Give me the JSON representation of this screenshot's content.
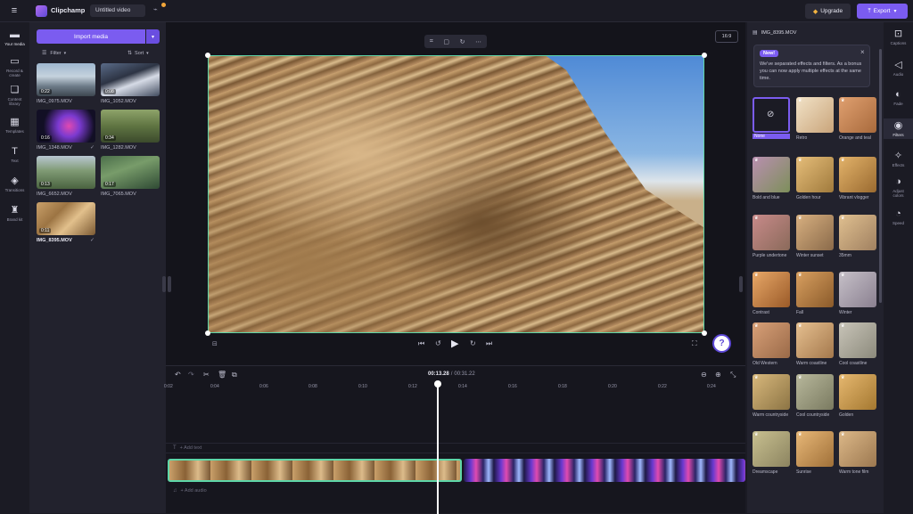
{
  "app": {
    "name": "Clipchamp",
    "project_title": "Untitled video"
  },
  "topbar": {
    "upgrade_label": "Upgrade",
    "export_label": "Export"
  },
  "left_rail": [
    {
      "label": "Your media",
      "icon": "folder-icon"
    },
    {
      "label": "Record & create",
      "icon": "camera-icon"
    },
    {
      "label": "Content library",
      "icon": "library-icon"
    },
    {
      "label": "Templates",
      "icon": "templates-icon"
    },
    {
      "label": "Text",
      "icon": "text-icon"
    },
    {
      "label": "Transitions",
      "icon": "transitions-icon"
    },
    {
      "label": "Brand kit",
      "icon": "brandkit-icon"
    }
  ],
  "media": {
    "import_label": "Import media",
    "filter_label": "Filter",
    "sort_label": "Sort",
    "items": [
      {
        "name": "IMG_0975.MOV",
        "duration": "0:22"
      },
      {
        "name": "IMG_1052.MOV",
        "duration": "0:08"
      },
      {
        "name": "IMG_1348.MOV",
        "duration": "0:16"
      },
      {
        "name": "IMG_1282.MOV",
        "duration": "0:34"
      },
      {
        "name": "IMG_6652.MOV",
        "duration": "0:13"
      },
      {
        "name": "IMG_7065.MOV",
        "duration": "0:17"
      },
      {
        "name": "IMG_8395.MOV",
        "duration": "0:11"
      }
    ]
  },
  "preview": {
    "aspect_ratio": "16:9"
  },
  "timeline": {
    "current_time": "00:13.28",
    "total_time": "00:31.22",
    "separator": "/",
    "ruler": [
      "0:02",
      "0:04",
      "0:06",
      "0:08",
      "0:10",
      "0:12",
      "0:14",
      "0:16",
      "0:18",
      "0:20",
      "0:22",
      "0:24"
    ],
    "add_text": "+ Add text",
    "add_audio": "+ Add audio"
  },
  "right_panel": {
    "file_name": "IMG_8395.MOV",
    "badge": "New!",
    "notice": "We've separated effects and filters. As a bonus you can now apply multiple effects at the same time.",
    "filters": [
      {
        "name": "None"
      },
      {
        "name": "Retro"
      },
      {
        "name": "Orange and teal"
      },
      {
        "name": "Bold and blue"
      },
      {
        "name": "Golden hour"
      },
      {
        "name": "Vibrant vlogger"
      },
      {
        "name": "Purple undertone"
      },
      {
        "name": "Winter sunset"
      },
      {
        "name": "35mm"
      },
      {
        "name": "Contrast"
      },
      {
        "name": "Fall"
      },
      {
        "name": "Winter"
      },
      {
        "name": "Old Western"
      },
      {
        "name": "Warm coastline"
      },
      {
        "name": "Cool coastline"
      },
      {
        "name": "Warm countryside"
      },
      {
        "name": "Cool countryside"
      },
      {
        "name": "Golden"
      },
      {
        "name": "Dreamscape"
      },
      {
        "name": "Sunrise"
      },
      {
        "name": "Warm tone film"
      }
    ]
  },
  "right_rail": [
    {
      "label": "Captions"
    },
    {
      "label": "Audio"
    },
    {
      "label": "Fade"
    },
    {
      "label": "Filters"
    },
    {
      "label": "Effects"
    },
    {
      "label": "Adjust colors"
    },
    {
      "label": "Speed"
    }
  ],
  "colors": {
    "accent": "#7b5cf0",
    "selection_border": "#5ed6a8"
  }
}
